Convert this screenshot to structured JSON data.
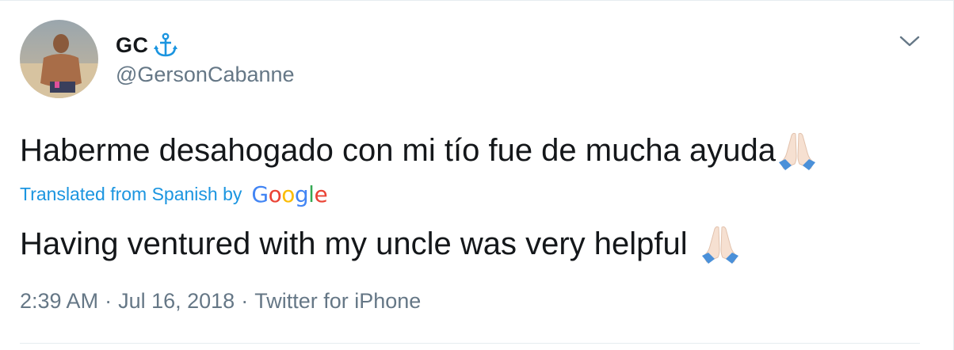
{
  "user": {
    "display_name": "GC",
    "handle": "@GersonCabanne"
  },
  "tweet": {
    "original_text": "Haberme desahogado con mi tío fue de mucha ayuda",
    "translation_label": "Translated from Spanish by",
    "translation_provider": {
      "letters": [
        "G",
        "o",
        "o",
        "g",
        "l",
        "e"
      ],
      "colors": [
        "#4285f4",
        "#ea4335",
        "#fbbc05",
        "#4285f4",
        "#34a853",
        "#ea4335"
      ]
    },
    "translated_text": "Having ventured with my uncle was very helpful",
    "time": "2:39 AM",
    "separator": "·",
    "date": "Jul 16, 2018",
    "source": "Twitter for iPhone"
  },
  "icons": {
    "anchor": "anchor-icon",
    "caret": "chevron-down-icon",
    "emoji": "folded-hands-emoji"
  },
  "colors": {
    "link": "#1b95e0",
    "secondary_text": "#657786",
    "primary_text": "#14171a",
    "anchor": "#1b95e0"
  }
}
